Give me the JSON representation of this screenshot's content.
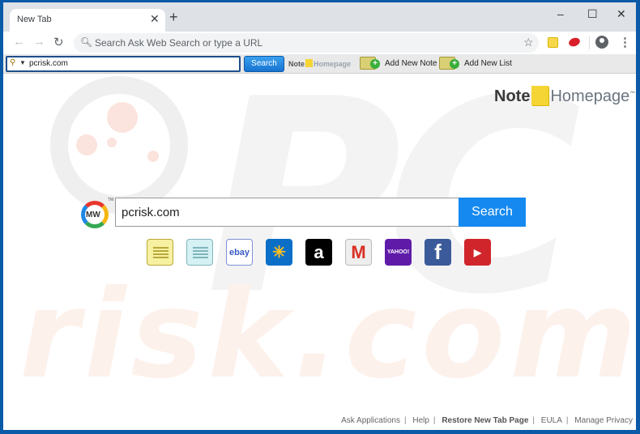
{
  "browser": {
    "tab_title": "New Tab",
    "omnibox_placeholder": "Search Ask Web Search or type a URL",
    "window_controls": {
      "minimize": "–",
      "maximize": "☐",
      "close": "✕"
    }
  },
  "extension_toolbar": {
    "search_value": "pcrisk.com",
    "search_button": "Search",
    "logo_note": "Note",
    "logo_homepage": "Homepage",
    "actions": [
      {
        "label": "Add New Note",
        "icon": "add-note-icon"
      },
      {
        "label": "Add New List",
        "icon": "add-list-icon"
      }
    ]
  },
  "page": {
    "logo_note": "Note",
    "logo_homepage": "Homepage",
    "logo_tm": "™",
    "mw_logo_text": "MW",
    "mw_tm": "TM",
    "search_value": "pcrisk.com",
    "search_button": "Search",
    "watermark_top": "PC",
    "watermark_bottom": "risk.com",
    "tiles": [
      {
        "name": "notes",
        "label": "",
        "bg": "#f7f0a0",
        "fg": "#b9a93a"
      },
      {
        "name": "lists",
        "label": "",
        "bg": "#d5f1f3",
        "fg": "#7fb4bb"
      },
      {
        "name": "ebay",
        "label": "ebay",
        "bg": "#ffffff",
        "fg": "#3a5bc7"
      },
      {
        "name": "walmart",
        "label": "✳",
        "bg": "#0b6fc7",
        "fg": "#ffc220"
      },
      {
        "name": "amazon",
        "label": "a",
        "bg": "#000000",
        "fg": "#ffffff"
      },
      {
        "name": "gmail",
        "label": "M",
        "bg": "#eeeeee",
        "fg": "#d93025"
      },
      {
        "name": "yahoo",
        "label": "YAHOO!",
        "bg": "#5f1ba8",
        "fg": "#ffffff"
      },
      {
        "name": "facebook",
        "label": "f",
        "bg": "#3b5a9a",
        "fg": "#ffffff"
      },
      {
        "name": "youtube",
        "label": "▶",
        "bg": "#d0262b",
        "fg": "#ffffff"
      }
    ],
    "footer": [
      {
        "label": "Ask Applications",
        "bold": false
      },
      {
        "label": "Help",
        "bold": false
      },
      {
        "label": "Restore New Tab Page",
        "bold": true
      },
      {
        "label": "EULA",
        "bold": false
      },
      {
        "label": "Manage Privacy",
        "bold": false
      }
    ]
  },
  "colors": {
    "frame": "#0a5aa8",
    "search_button": "#1589f0"
  }
}
